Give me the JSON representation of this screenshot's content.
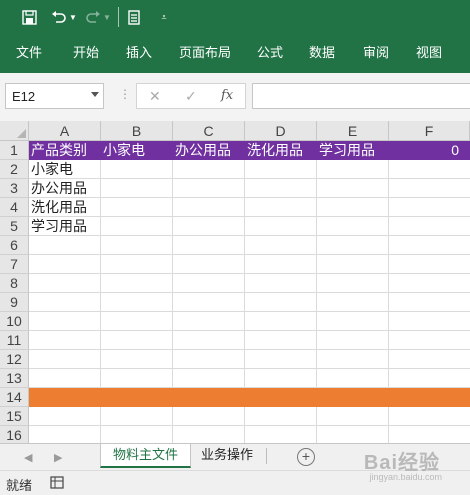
{
  "colors": {
    "ribbon": "#217346",
    "header_row_fill": "#7030A0",
    "highlight_row_fill": "#ED7D31"
  },
  "quick_access": {
    "icons": [
      "save-icon",
      "undo-icon",
      "redo-icon",
      "form-icon",
      "customize-icon"
    ]
  },
  "ribbon_tabs": [
    "文件",
    "开始",
    "插入",
    "页面布局",
    "公式",
    "数据",
    "审阅",
    "视图"
  ],
  "formula_bar": {
    "name_box": "E12",
    "fx_label": "fx",
    "formula": ""
  },
  "grid": {
    "columns": [
      "A",
      "B",
      "C",
      "D",
      "E",
      "F"
    ],
    "rows": [
      "1",
      "2",
      "3",
      "4",
      "5",
      "6",
      "7",
      "8",
      "9",
      "10",
      "11",
      "12",
      "13",
      "14",
      "15",
      "16"
    ],
    "row1": {
      "A": "产品类别",
      "B": "小家电",
      "C": "办公用品",
      "D": "洗化用品",
      "E": "学习用品",
      "F": "0"
    },
    "colA": {
      "r2": "小家电",
      "r3": "办公用品",
      "r4": "洗化用品",
      "r5": "学习用品"
    }
  },
  "sheet_tabs": [
    "物料主文件",
    "业务操作"
  ],
  "status": {
    "ready": "就绪"
  },
  "watermark": {
    "brand": "Bai经验",
    "url": "jingyan.baidu.com"
  }
}
